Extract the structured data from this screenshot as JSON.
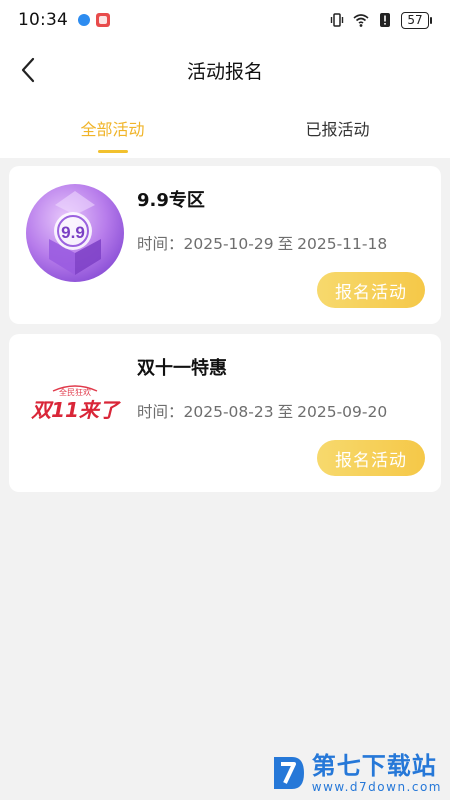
{
  "status_bar": {
    "time": "10:34",
    "battery": "57",
    "icons": [
      "notification-dot-icon",
      "app-notification-icon",
      "vibrate-icon",
      "wifi-icon",
      "alert-icon",
      "battery-icon"
    ]
  },
  "nav": {
    "title": "活动报名",
    "back_icon": "chevron-left-icon"
  },
  "tabs": [
    {
      "label": "全部活动",
      "active": true
    },
    {
      "label": "已报活动",
      "active": false
    }
  ],
  "activities": [
    {
      "title": "9.9专区",
      "time_label": "时间：",
      "start": "2025-10-29",
      "range_sep": "至",
      "end": "2025-11-18",
      "button": "报名活动",
      "thumb_icon": "nine-nine-badge-icon",
      "thumb_text": "9.9"
    },
    {
      "title": "双十一特惠",
      "time_label": "时间：",
      "start": "2025-08-23",
      "range_sep": "至",
      "end": "2025-09-20",
      "button": "报名活动",
      "thumb_icon": "double-eleven-logo-icon",
      "thumb_text": "双11来了",
      "thumb_subtext": "全民狂欢"
    }
  ],
  "watermark": {
    "name": "第七下载站",
    "url": "www.d7down.com"
  },
  "colors": {
    "accent": "#f0b429",
    "button": "#f5c848",
    "background": "#f2f2f2",
    "watermark": "#2678d8"
  }
}
